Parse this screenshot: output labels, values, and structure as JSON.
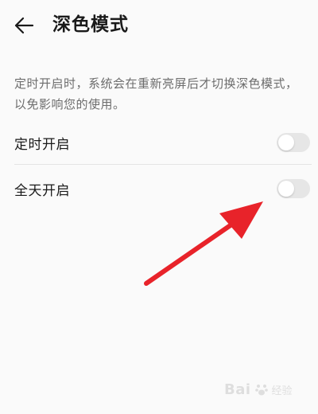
{
  "header": {
    "title": "深色模式",
    "back_icon": "arrow-left-icon"
  },
  "description": "定时开启时，系统会在重新亮屏后才切换深色模式，以免影响您的使用。",
  "settings": [
    {
      "label": "定时开启",
      "enabled": false
    },
    {
      "label": "全天开启",
      "enabled": false
    }
  ],
  "colors": {
    "background": "#fafafa",
    "switch_off": "#e6e6e6",
    "annotation_arrow": "#e8232a"
  },
  "watermark": {
    "text": "Bai",
    "sub": "经验"
  }
}
